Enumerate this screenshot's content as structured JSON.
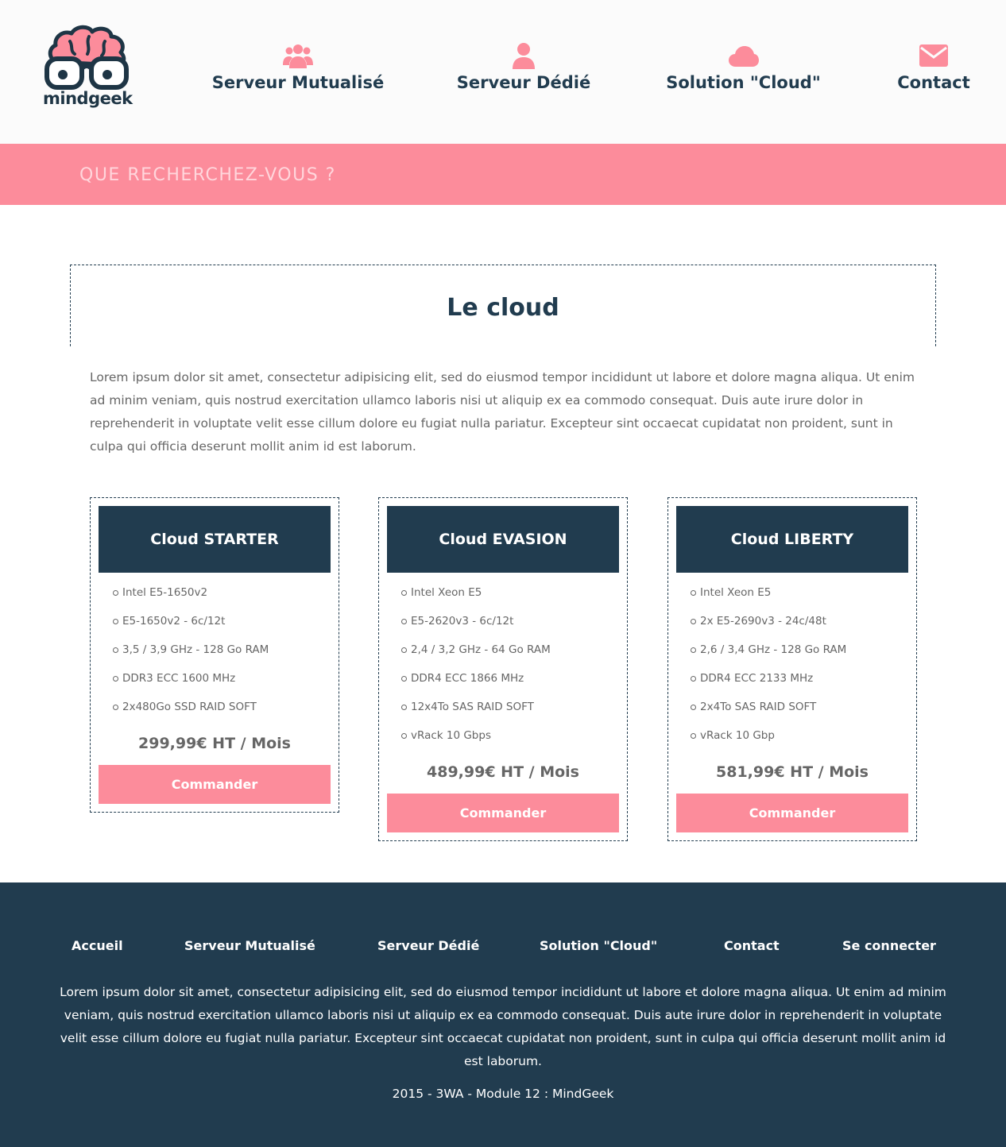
{
  "colors": {
    "navy": "#213c4f",
    "pink": "#fc8c9b",
    "header_bg": "#fbfbfb"
  },
  "brand": {
    "name": "mindgeek",
    "logo_icon": "brain-glasses-logo"
  },
  "nav": [
    {
      "label": "Serveur Mutualisé",
      "icon": "users-icon"
    },
    {
      "label": "Serveur Dédié",
      "icon": "user-icon"
    },
    {
      "label": "Solution \"Cloud\"",
      "icon": "cloud-icon"
    },
    {
      "label": "Contact",
      "icon": "envelope-icon"
    }
  ],
  "search": {
    "placeholder": "QUE RECHERCHEZ-VOUS ?"
  },
  "section": {
    "title": "Le cloud",
    "intro": "Lorem ipsum dolor sit amet, consectetur adipisicing elit, sed do eiusmod tempor incididunt ut labore et dolore magna aliqua. Ut enim ad minim veniam, quis nostrud exercitation ullamco laboris nisi ut aliquip ex ea commodo consequat. Duis aute irure dolor in reprehenderit in voluptate velit esse cillum dolore eu fugiat nulla pariatur. Excepteur sint occaecat cupidatat non proident, sunt in culpa qui officia deserunt mollit anim id est laborum."
  },
  "plans": [
    {
      "name": "Cloud STARTER",
      "features": [
        "Intel E5-1650v2",
        "E5-1650v2 - 6c/12t",
        "3,5 / 3,9 GHz - 128 Go RAM",
        "DDR3 ECC 1600 MHz",
        "2x480Go SSD RAID SOFT"
      ],
      "price": "299,99€ HT / Mois",
      "button": "Commander"
    },
    {
      "name": "Cloud EVASION",
      "features": [
        "Intel Xeon E5",
        "E5-2620v3 - 6c/12t",
        "2,4 / 3,2 GHz - 64 Go RAM",
        "DDR4 ECC 1866 MHz",
        "12x4To SAS RAID SOFT",
        "vRack 10 Gbps"
      ],
      "price": "489,99€ HT / Mois",
      "button": "Commander"
    },
    {
      "name": "Cloud LIBERTY",
      "features": [
        "Intel Xeon E5",
        "2x E5-2690v3 - 24c/48t",
        "2,6 / 3,4 GHz - 128 Go RAM",
        "DDR4 ECC 2133 MHz",
        "2x4To SAS RAID SOFT",
        "vRack 10 Gbp"
      ],
      "price": "581,99€ HT / Mois",
      "button": "Commander"
    }
  ],
  "footer": {
    "links": [
      "Accueil",
      "Serveur Mutualisé",
      "Serveur Dédié",
      "Solution \"Cloud\"",
      "Contact",
      "Se connecter"
    ],
    "text": "Lorem ipsum dolor sit amet, consectetur adipisicing elit, sed do eiusmod tempor incididunt ut labore et dolore magna aliqua. Ut enim ad minim veniam, quis nostrud exercitation ullamco laboris nisi ut aliquip ex ea commodo consequat. Duis aute irure dolor in reprehenderit in voluptate velit esse cillum dolore eu fugiat nulla pariatur. Excepteur sint occaecat cupidatat non proident, sunt in culpa qui officia deserunt mollit anim id est laborum.",
    "copyright": "2015 - 3WA - Module 12 : MindGeek"
  }
}
